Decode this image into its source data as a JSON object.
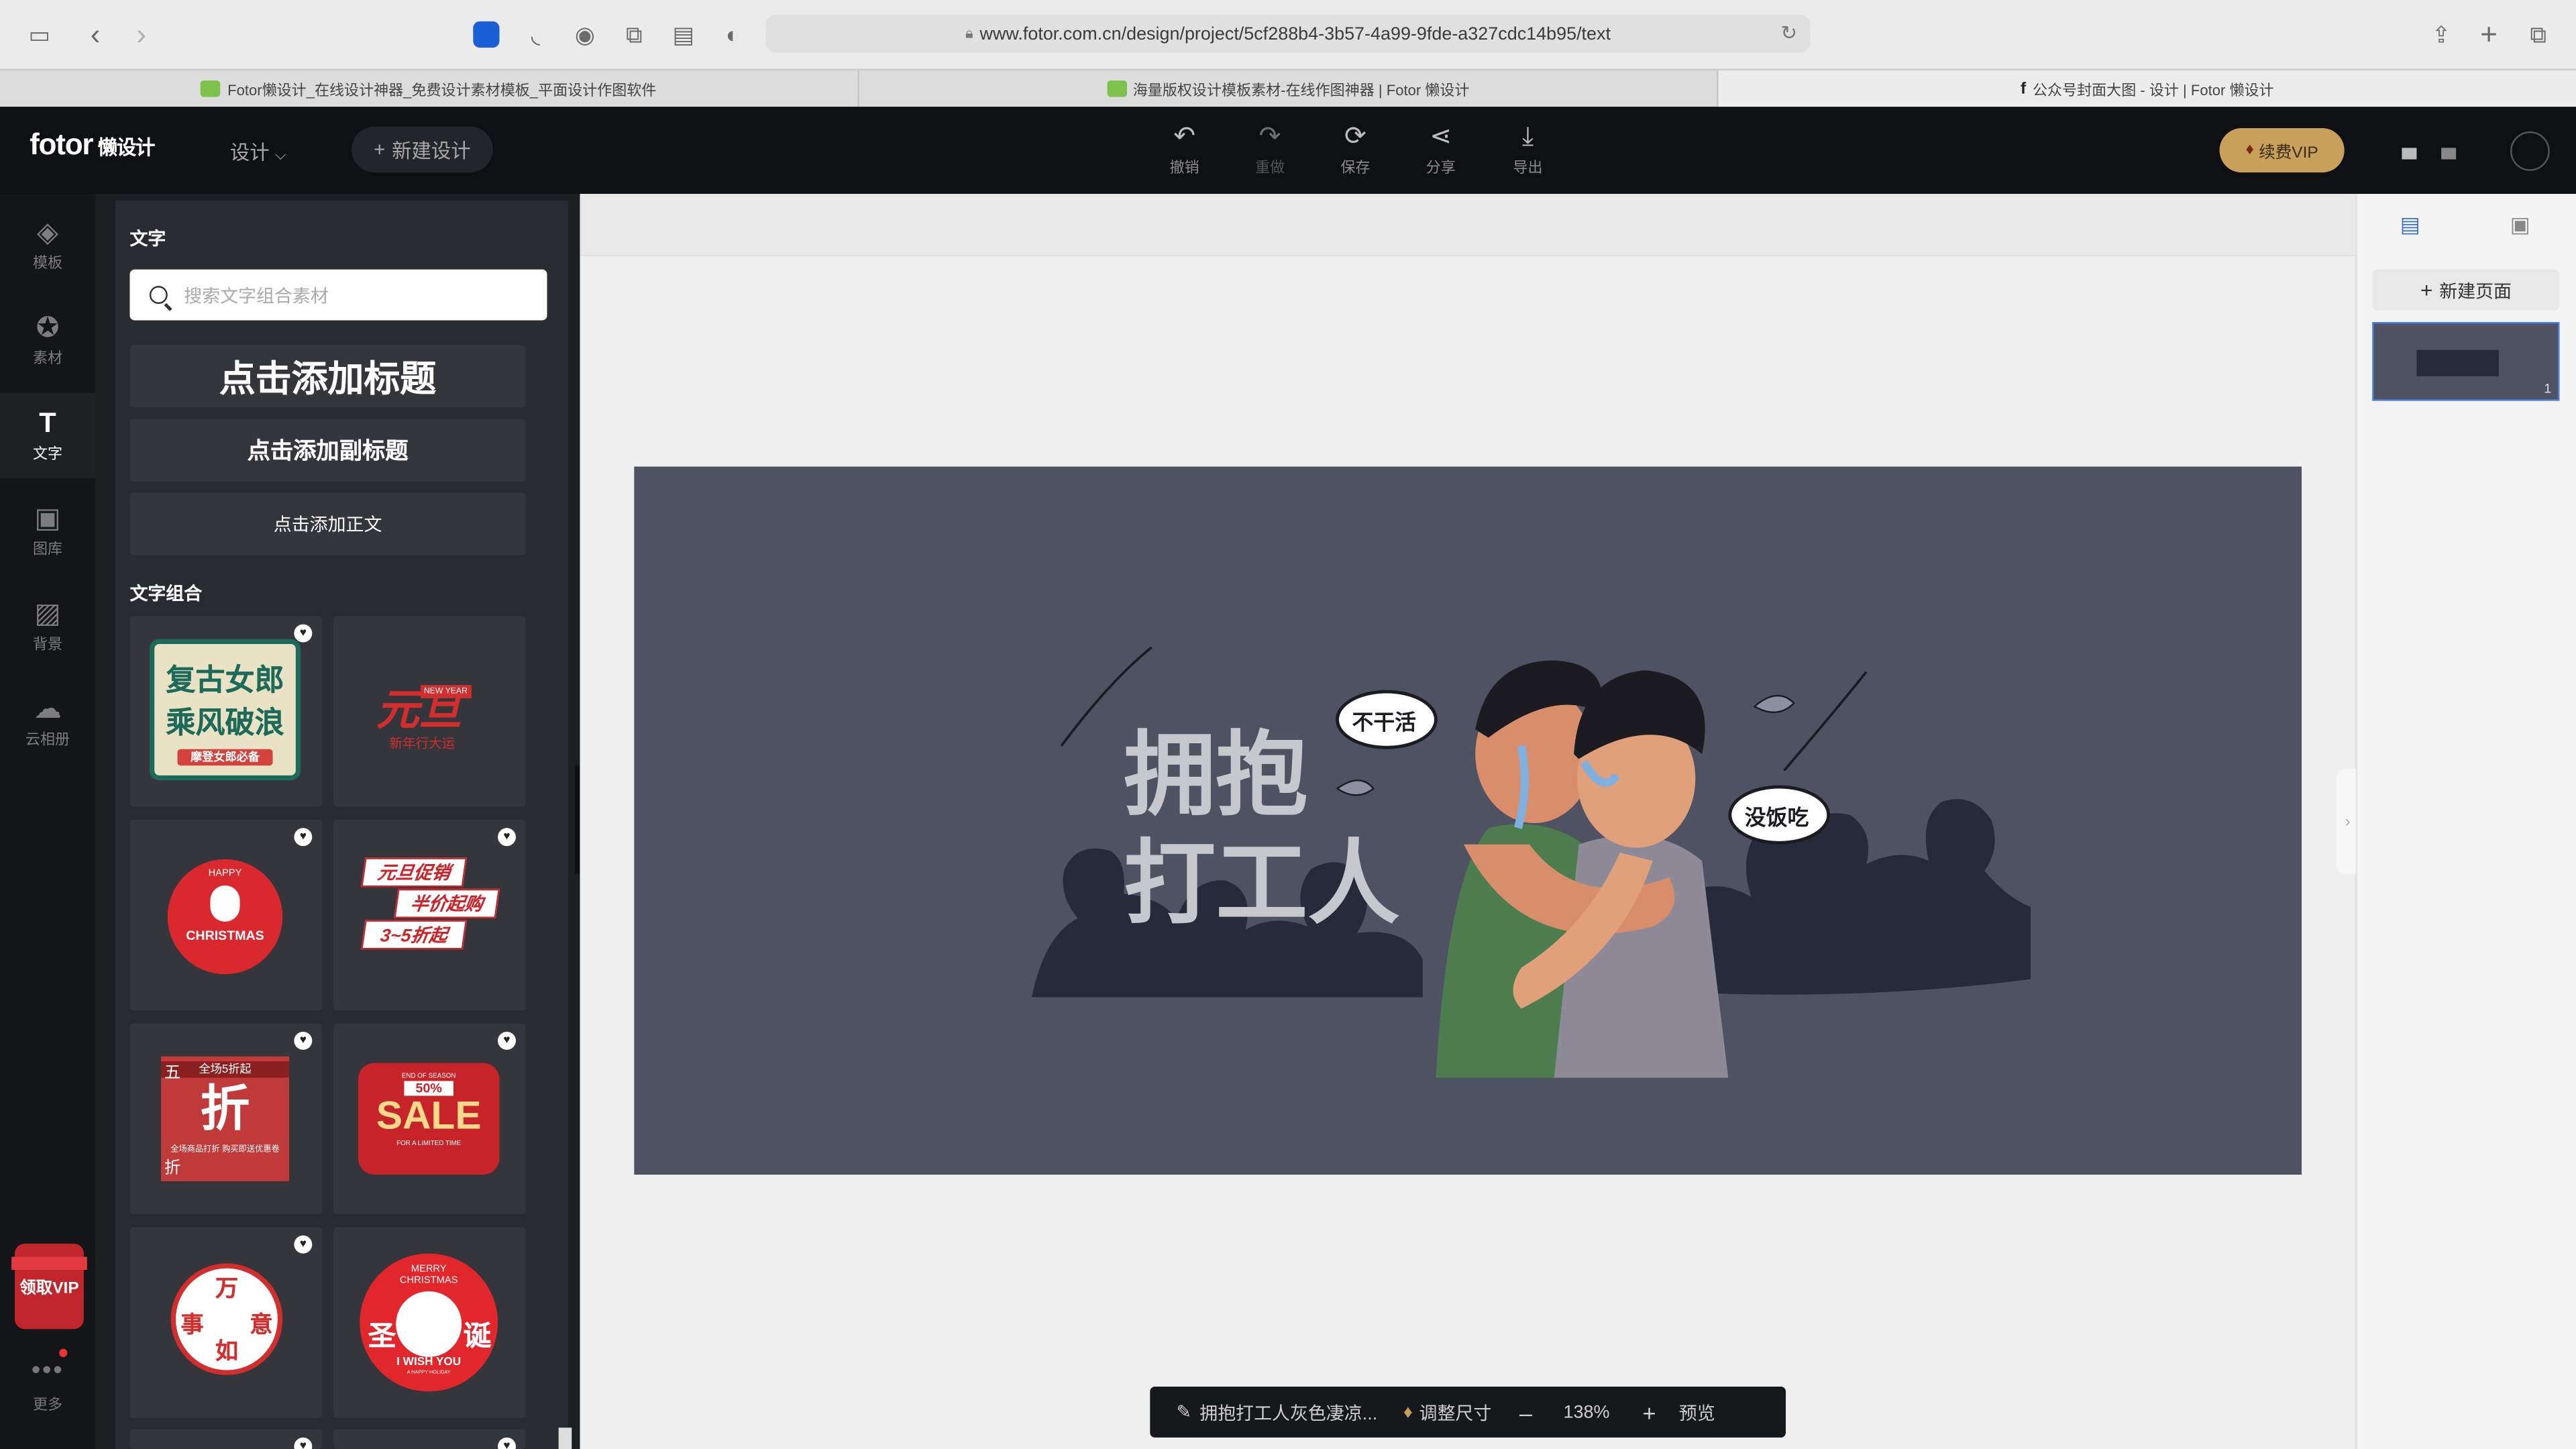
{
  "browser": {
    "url": "www.fotor.com.cn/design/project/5cf288b4-3b57-4a99-9fde-a327cdc14b95/text",
    "tabs": [
      {
        "label": "Fotor懒设计_在线设计神器_免费设计素材模板_平面设计作图软件",
        "favicon_color": "#7cc24a"
      },
      {
        "label": "海量版权设计模板素材-在线作图神器 | Fotor 懒设计",
        "favicon_color": "#7cc24a"
      },
      {
        "label": "公众号封面大图 - 设计 | Fotor 懒设计",
        "favicon_color": "#222222"
      }
    ]
  },
  "header": {
    "logo": "fotor",
    "logo_cn": "懒设计",
    "design_menu": "设计",
    "new_design": "新建设计",
    "tools": [
      {
        "icon": "undo-icon",
        "label": "撤销"
      },
      {
        "icon": "redo-icon",
        "label": "重做"
      },
      {
        "icon": "save-icon",
        "label": "保存"
      },
      {
        "icon": "share-icon",
        "label": "分享"
      },
      {
        "icon": "download-icon",
        "label": "导出"
      }
    ],
    "vip": "续费VIP"
  },
  "rail": [
    {
      "icon": "layers-icon",
      "label": "模板"
    },
    {
      "icon": "star-icon",
      "label": "素材"
    },
    {
      "icon": "text-icon",
      "label": "文字"
    },
    {
      "icon": "image-icon",
      "label": "图库"
    },
    {
      "icon": "background-icon",
      "label": "背景"
    },
    {
      "icon": "cloud-upload-icon",
      "label": "云相册"
    }
  ],
  "rail_gift": "领取VIP",
  "rail_more": "更多",
  "panel": {
    "title": "文字",
    "search_placeholder": "搜索文字组合素材",
    "add_title": "点击添加标题",
    "add_subtitle": "点击添加副标题",
    "add_body": "点击添加正文",
    "combo_title": "文字组合",
    "combos": {
      "c1": {
        "line1": "复古女郎",
        "line2": "乘风破浪",
        "tag": "摩登女郎必备"
      },
      "c2": {
        "main": "元旦",
        "badge": "NEW YEAR",
        "sub": "新年行大运"
      },
      "c3": {
        "top": "HAPPY",
        "bottom": "CHRISTMAS"
      },
      "c4": {
        "l1": "元旦促销",
        "l2": "半价起购",
        "l3": "3~5折起"
      },
      "c5": {
        "top": "全场5折起",
        "main": "折",
        "corner": "五",
        "corner2": "折",
        "bottom": "全场商品打折 购买即送优惠卷"
      },
      "c6": {
        "top": "END OF SEASON",
        "badge": "50%",
        "main": "SALE",
        "sub": "FOR A LIMITED TIME"
      },
      "c7": {
        "chars": [
          "万",
          "事",
          "如",
          "意"
        ]
      },
      "c8": {
        "top": "MERRY CHRISTMAS",
        "left": "圣",
        "right": "诞",
        "bottom": "I WISH YOU",
        "tiny": "A HAPPY HOLIDAY"
      }
    }
  },
  "canvas": {
    "headline1": "拥抱",
    "headline2": "打工人",
    "bubble1": "不干活",
    "bubble2": "没饭吃",
    "artboard_color": "#4f5262"
  },
  "bottombar": {
    "name": "拥抱打工人灰色凄凉...",
    "resize": "调整尺寸",
    "zoom": "138%",
    "preview": "预览"
  },
  "rpanel": {
    "new_page": "新建页面",
    "page_number": "1"
  }
}
